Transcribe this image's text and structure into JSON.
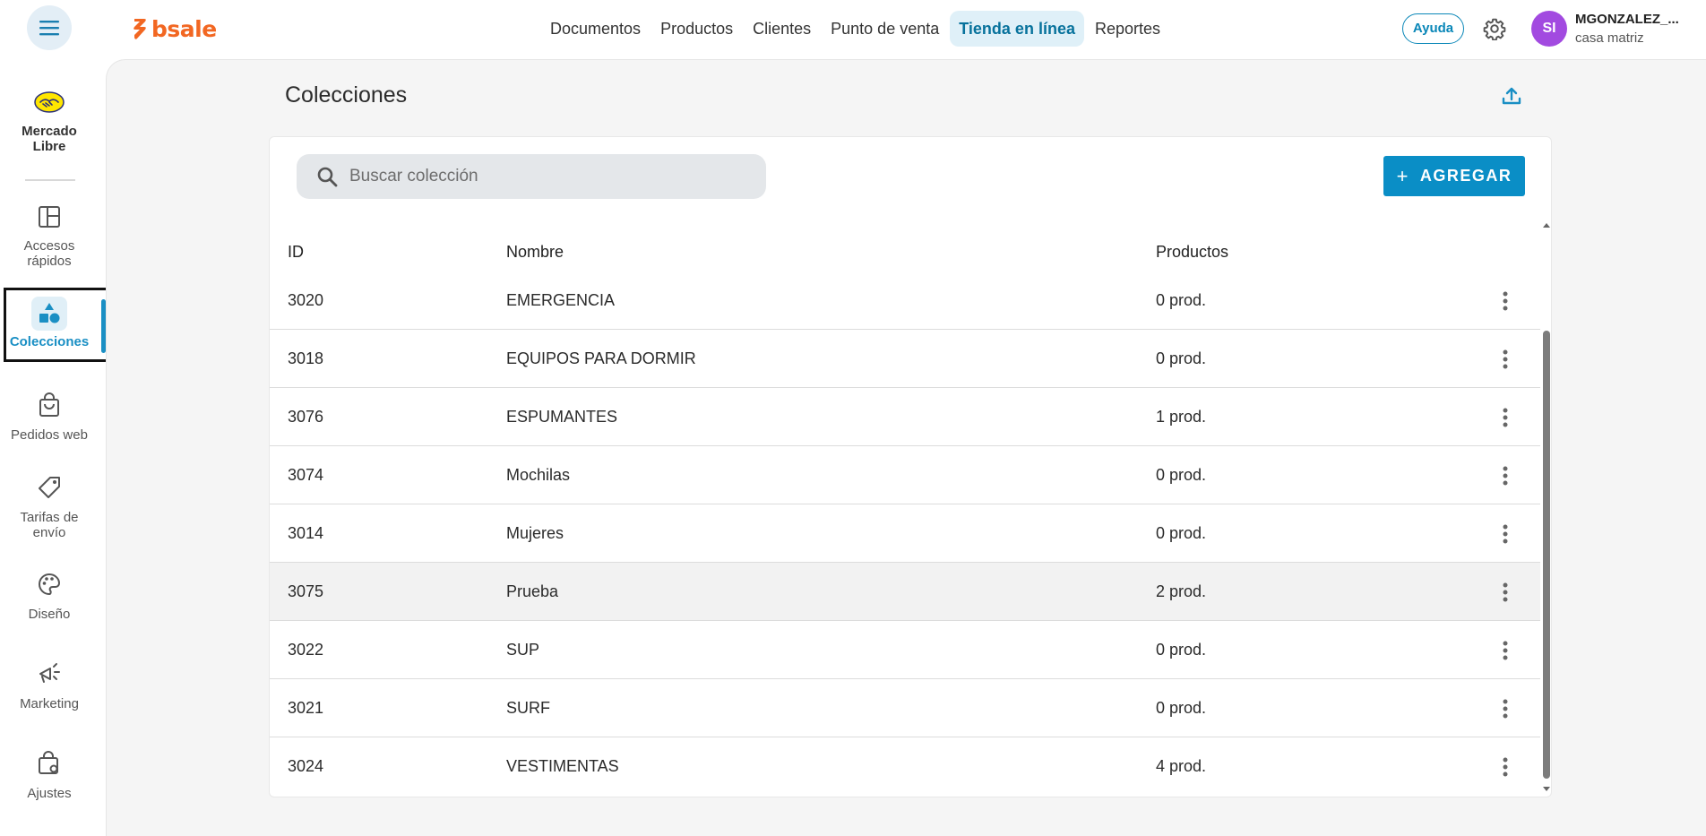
{
  "brand": {
    "name": "bsale",
    "color": "#f26722"
  },
  "nav": {
    "items": [
      {
        "label": "Documentos",
        "active": false
      },
      {
        "label": "Productos",
        "active": false
      },
      {
        "label": "Clientes",
        "active": false
      },
      {
        "label": "Punto de venta",
        "active": false
      },
      {
        "label": "Tienda en línea",
        "active": true
      },
      {
        "label": "Reportes",
        "active": false
      }
    ]
  },
  "header": {
    "help_label": "Ayuda",
    "avatar_initials": "SI",
    "user_name": "MGONZALEZ_...",
    "user_branch": "casa matriz"
  },
  "sidebar": {
    "items": [
      {
        "label_line1": "Mercado",
        "label_line2": "Libre",
        "icon": "handshake-icon"
      },
      {
        "label_line1": "Accesos",
        "label_line2": "rápidos",
        "icon": "layout-icon"
      },
      {
        "label_line1": "Colecciones",
        "label_line2": "",
        "icon": "shapes-icon",
        "active": true
      },
      {
        "label_line1": "Pedidos web",
        "label_line2": "",
        "icon": "shopping-bag-icon"
      },
      {
        "label_line1": "Tarifas de",
        "label_line2": "envío",
        "icon": "tag-icon"
      },
      {
        "label_line1": "Diseño",
        "label_line2": "",
        "icon": "palette-icon"
      },
      {
        "label_line1": "Marketing",
        "label_line2": "",
        "icon": "megaphone-icon"
      },
      {
        "label_line1": "Ajustes",
        "label_line2": "",
        "icon": "settings-bag-icon"
      }
    ]
  },
  "page": {
    "title": "Colecciones",
    "search_placeholder": "Buscar colección",
    "add_label": "AGREGAR"
  },
  "table": {
    "columns": [
      "ID",
      "Nombre",
      "Productos"
    ],
    "rows": [
      {
        "id": "3020",
        "name": "EMERGENCIA",
        "products": "0 prod."
      },
      {
        "id": "3018",
        "name": "EQUIPOS PARA DORMIR",
        "products": "0 prod."
      },
      {
        "id": "3076",
        "name": "ESPUMANTES",
        "products": "1 prod."
      },
      {
        "id": "3074",
        "name": "Mochilas",
        "products": "0 prod."
      },
      {
        "id": "3014",
        "name": "Mujeres",
        "products": "0 prod."
      },
      {
        "id": "3075",
        "name": "Prueba",
        "products": "2 prod."
      },
      {
        "id": "3022",
        "name": "SUP",
        "products": "0 prod."
      },
      {
        "id": "3021",
        "name": "SURF",
        "products": "0 prod."
      },
      {
        "id": "3024",
        "name": "VESTIMENTAS",
        "products": "4 prod."
      }
    ]
  },
  "colors": {
    "accent": "#0a8ec6",
    "active_nav_bg": "#dff0f8",
    "avatar": "#a24ae0"
  }
}
